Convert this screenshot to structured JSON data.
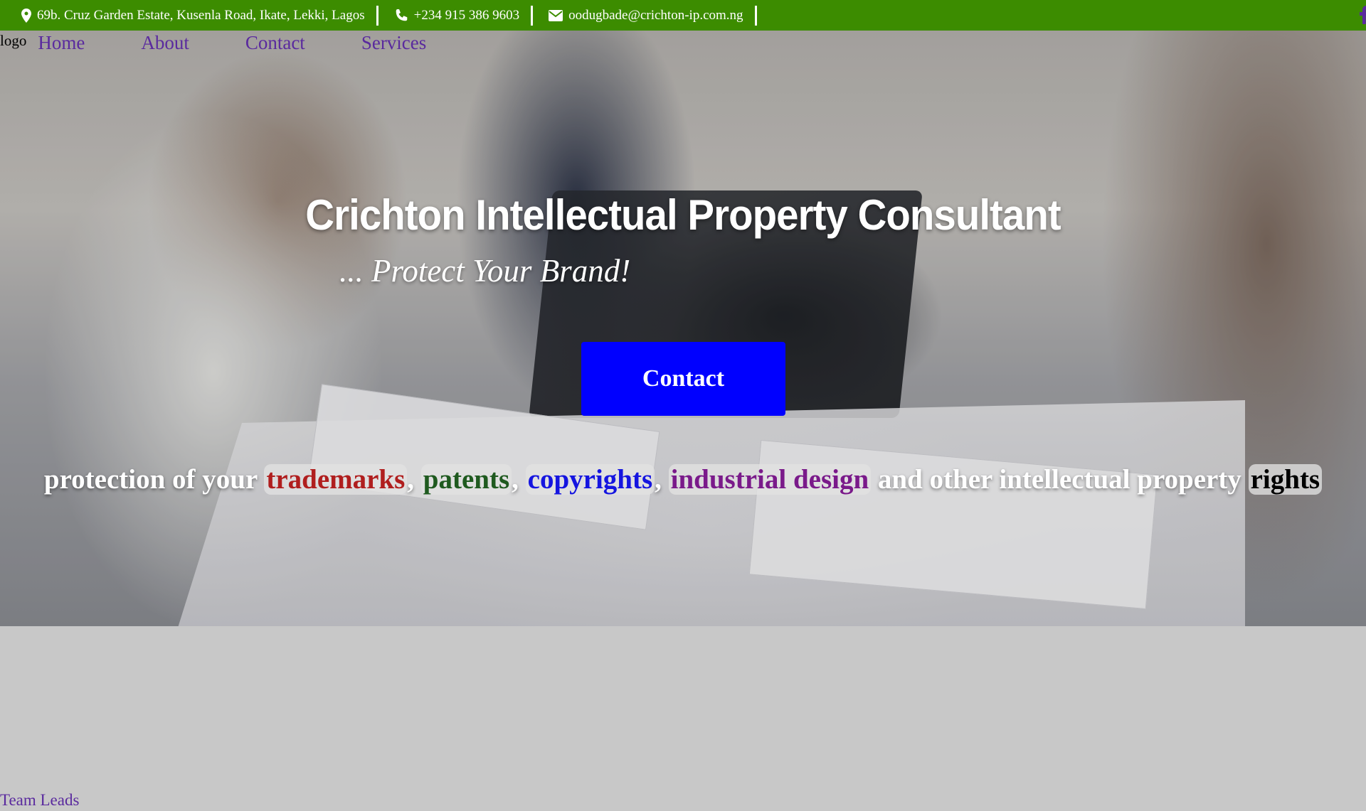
{
  "topbar": {
    "address": "69b. Cruz Garden Estate, Kusenla Road, Ikate, Lekki, Lagos",
    "phone": "+234 915 386 9603",
    "email": "oodugbade@crichton-ip.com.ng",
    "icons": [
      "map-pin-icon",
      "phone-icon",
      "envelope-icon",
      "facebook-icon"
    ],
    "background": "#3c8c00"
  },
  "nav": {
    "logo": "logo",
    "links": [
      "Home",
      "About",
      "Contact",
      "Services"
    ],
    "link_color": "#5a2a9e"
  },
  "hero": {
    "title": "Crichton Intellectual Property Consultant",
    "tagline": "... Protect Your Brand!",
    "cta": "Contact",
    "cta_color": "#0000ff",
    "ip_line": {
      "prefix": "protection of your",
      "trademarks": "trademarks",
      "patents": "patents",
      "copyrights": "copyrights",
      "industrial_design": "industrial design",
      "middle": "and other intellectual property",
      "rights": "rights",
      "colors": {
        "trademarks": "#b01e1e",
        "patents": "#1f5a1f",
        "copyrights": "#1515e0",
        "industrial_design": "#7a1a8a",
        "rights": "#000000"
      }
    }
  },
  "footer_link": "Team Leads"
}
